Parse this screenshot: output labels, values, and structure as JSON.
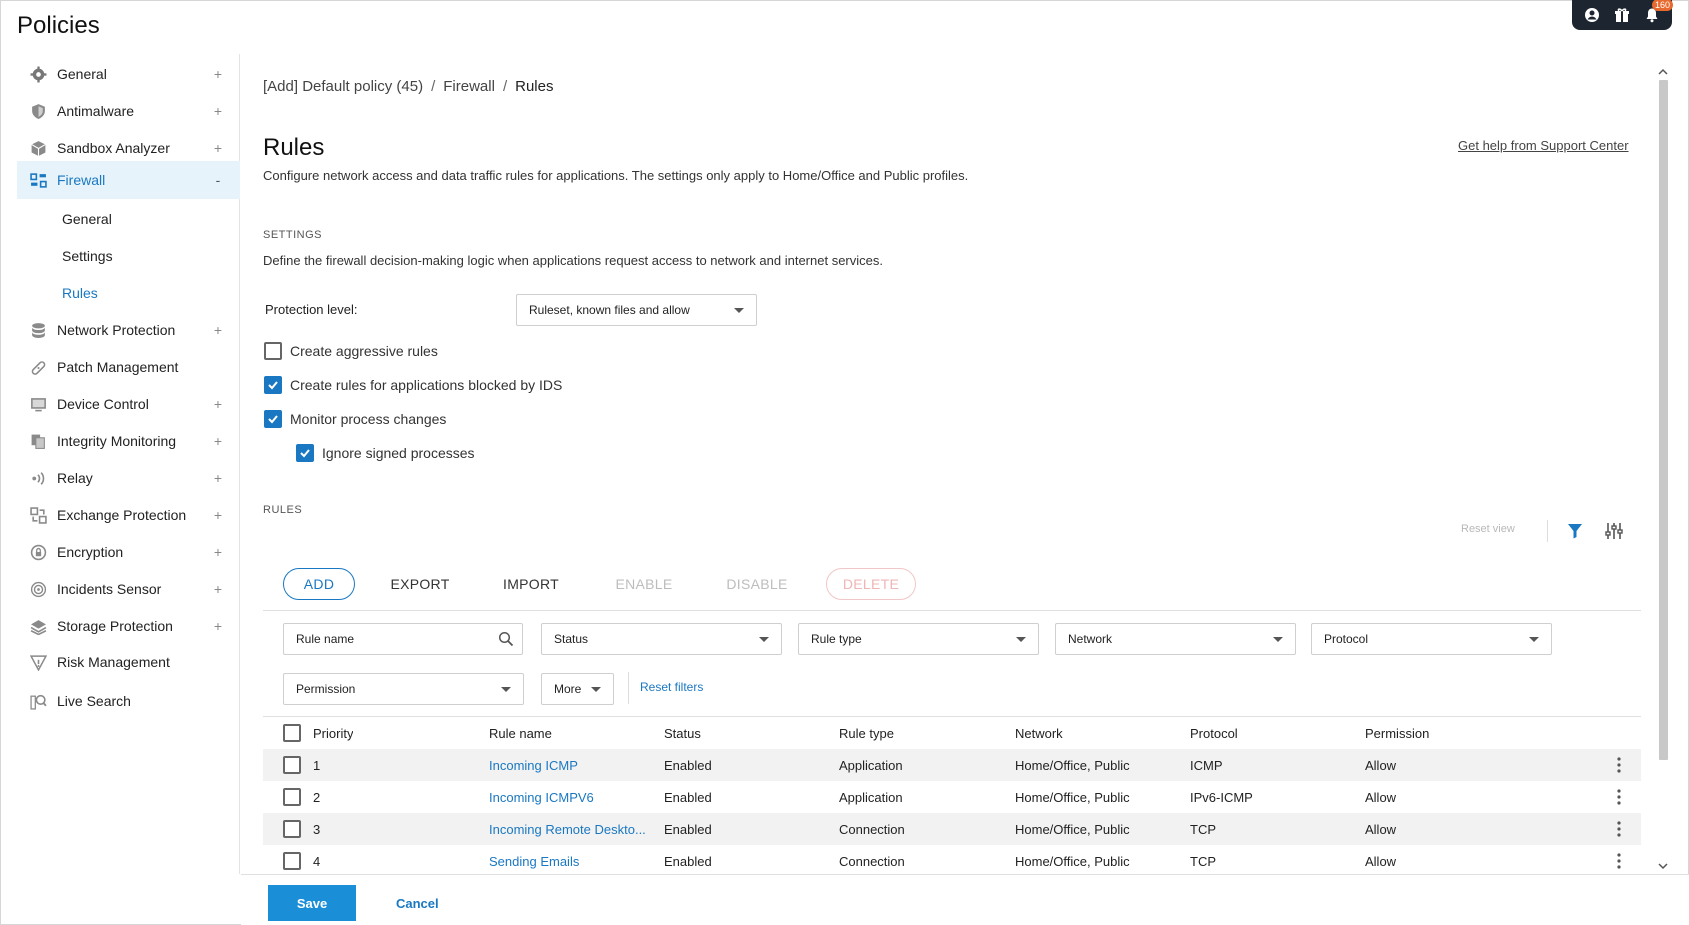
{
  "page": {
    "title": "Policies"
  },
  "topbar": {
    "notifications_count": "160"
  },
  "sidebar": {
    "items": [
      {
        "label": "General",
        "expander": "+",
        "icon": "gear-icon"
      },
      {
        "label": "Antimalware",
        "expander": "+",
        "icon": "shield-icon"
      },
      {
        "label": "Sandbox Analyzer",
        "expander": "+",
        "icon": "box-icon"
      },
      {
        "label": "Firewall",
        "expander": "-",
        "icon": "firewall-icon"
      },
      {
        "label": "Network Protection",
        "expander": "+",
        "icon": "database-icon"
      },
      {
        "label": "Patch Management",
        "expander": "",
        "icon": "bandage-icon"
      },
      {
        "label": "Device Control",
        "expander": "+",
        "icon": "monitor-icon"
      },
      {
        "label": "Integrity Monitoring",
        "expander": "+",
        "icon": "files-icon"
      },
      {
        "label": "Relay",
        "expander": "+",
        "icon": "broadcast-icon"
      },
      {
        "label": "Exchange Protection",
        "expander": "+",
        "icon": "exchange-icon"
      },
      {
        "label": "Encryption",
        "expander": "+",
        "icon": "lock-icon"
      },
      {
        "label": "Incidents Sensor",
        "expander": "+",
        "icon": "sensor-icon"
      },
      {
        "label": "Storage Protection",
        "expander": "+",
        "icon": "storage-icon"
      },
      {
        "label": "Risk Management",
        "expander": "",
        "icon": "risk-icon"
      },
      {
        "label": "Live Search",
        "expander": "",
        "icon": "live-search-icon"
      }
    ],
    "firewall_sub": [
      "General",
      "Settings",
      "Rules"
    ]
  },
  "breadcrumb": {
    "part1": "[Add] Default policy (45)",
    "part2": "Firewall",
    "part3": "Rules",
    "sep": "/"
  },
  "main": {
    "title": "Rules",
    "help_link": "Get help from Support Center",
    "description": "Configure network access and data traffic rules for applications. The settings only apply to Home/Office and Public profiles."
  },
  "settings": {
    "heading": "SETTINGS",
    "description": "Define the firewall decision-making logic when applications request access to network and internet services.",
    "protection_level_label": "Protection level:",
    "protection_level_value": "Ruleset, known files and allow",
    "checkboxes": [
      {
        "label": "Create aggressive rules",
        "checked": false
      },
      {
        "label": "Create rules for applications blocked by IDS",
        "checked": true
      },
      {
        "label": "Monitor process changes",
        "checked": true
      },
      {
        "label": "Ignore signed processes",
        "checked": true
      }
    ]
  },
  "rules": {
    "heading": "RULES",
    "reset_view": "Reset view",
    "buttons": {
      "add": "ADD",
      "export": "EXPORT",
      "import": "IMPORT",
      "enable": "ENABLE",
      "disable": "DISABLE",
      "delete": "DELETE"
    },
    "filters": {
      "search_placeholder": "Rule name",
      "status": "Status",
      "rule_type": "Rule type",
      "network": "Network",
      "protocol": "Protocol",
      "permission": "Permission",
      "more": "More",
      "reset_filters": "Reset filters"
    },
    "columns": [
      "Priority",
      "Rule name",
      "Status",
      "Rule type",
      "Network",
      "Protocol",
      "Permission"
    ],
    "rows": [
      {
        "priority": "1",
        "name": "Incoming ICMP",
        "status": "Enabled",
        "type": "Application",
        "network": "Home/Office, Public",
        "protocol": "ICMP",
        "permission": "Allow"
      },
      {
        "priority": "2",
        "name": "Incoming ICMPV6",
        "status": "Enabled",
        "type": "Application",
        "network": "Home/Office, Public",
        "protocol": "IPv6-ICMP",
        "permission": "Allow"
      },
      {
        "priority": "3",
        "name": "Incoming Remote Deskto...",
        "status": "Enabled",
        "type": "Connection",
        "network": "Home/Office, Public",
        "protocol": "TCP",
        "permission": "Allow"
      },
      {
        "priority": "4",
        "name": "Sending Emails",
        "status": "Enabled",
        "type": "Connection",
        "network": "Home/Office, Public",
        "protocol": "TCP",
        "permission": "Allow"
      }
    ]
  },
  "footer": {
    "save": "Save",
    "cancel": "Cancel"
  },
  "colors": {
    "accent": "#1a78c2",
    "save_bg": "#1a8fd8",
    "topbar_bg": "#1d2530",
    "badge": "#e8692d"
  }
}
